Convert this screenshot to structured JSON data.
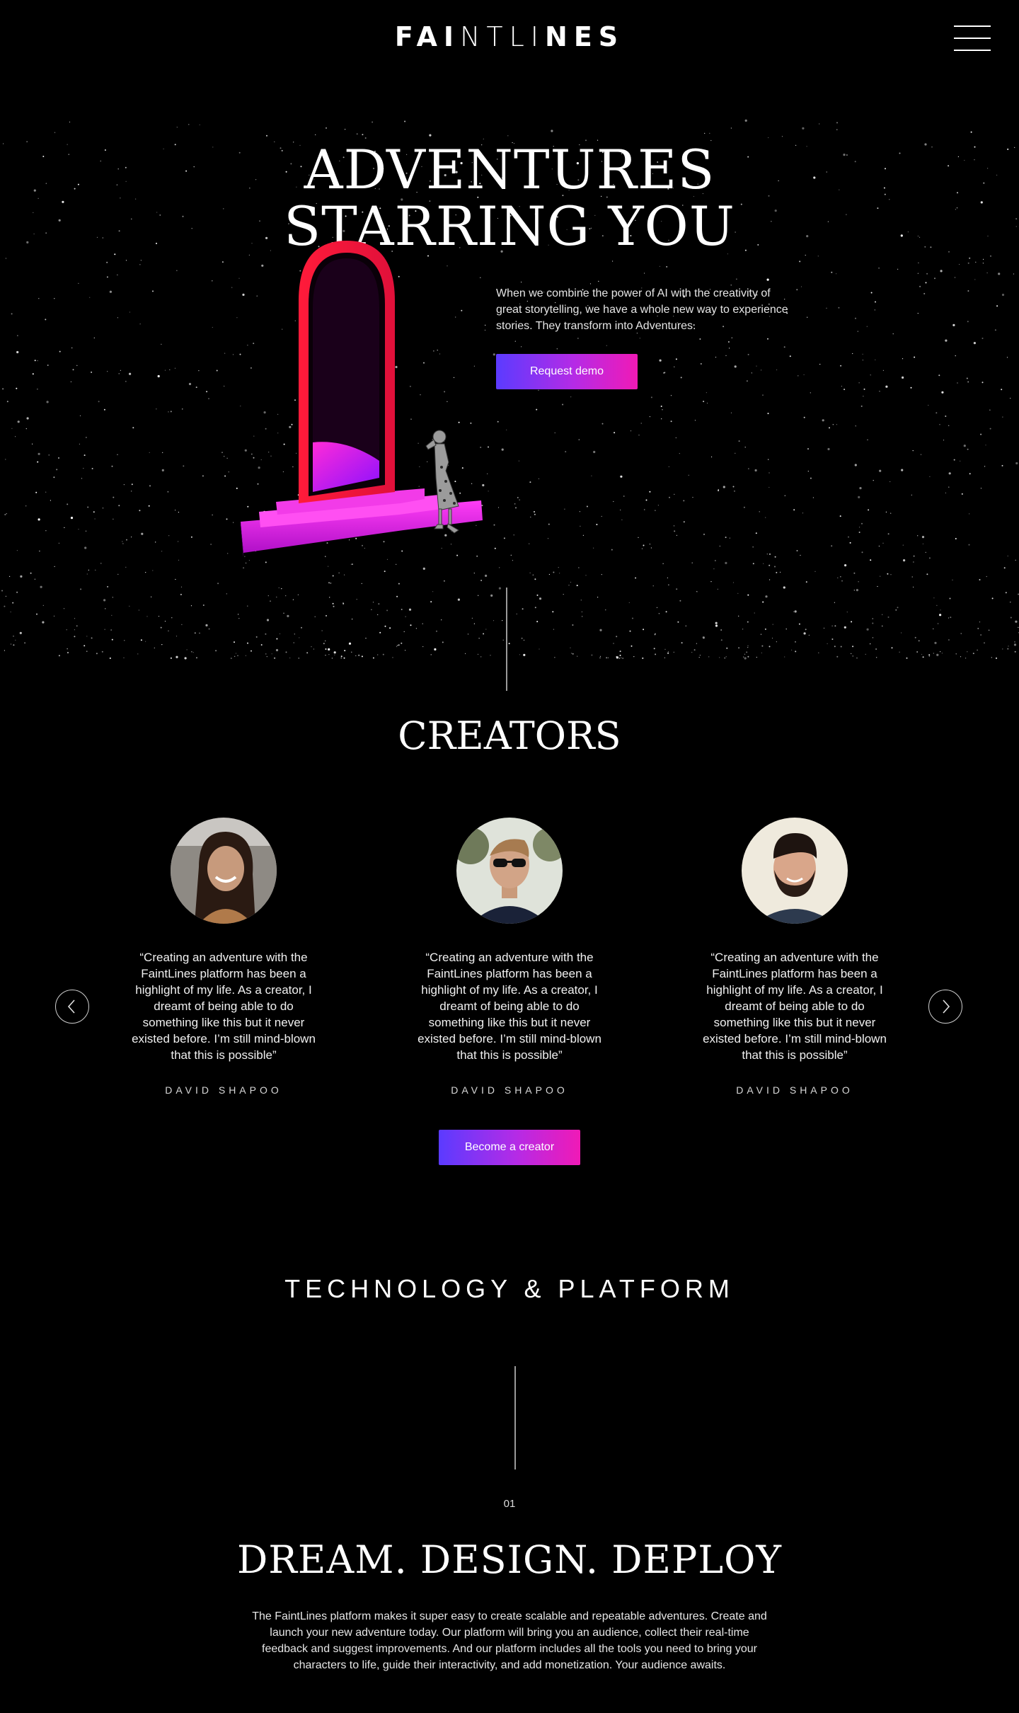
{
  "header": {
    "logo_bold_1": "FAI",
    "logo_thin": "NTLI",
    "logo_bold_2": "NES",
    "menu_icon": "hamburger-menu-icon"
  },
  "hero": {
    "title_line1": "ADVENTURES",
    "title_line2": "STARRING YOU",
    "description": "When we combine the power of AI with the creativity of great storytelling, we have a whole new way to experience stories. They transform into Adventures.",
    "cta_label": "Request demo"
  },
  "creators": {
    "title": "CREATORS",
    "items": [
      {
        "quote": "“Creating an adventure with the FaintLines platform has been a highlight of my life. As a creator, I dreamt of being able to do something like this but it never existed before. I’m still mind-blown that this is possible”",
        "author": "DAVID SHAPOO"
      },
      {
        "quote": "“Creating an adventure with the FaintLines platform has been a highlight of my life. As a creator, I dreamt of being able to do something like this but it never existed before. I’m still mind-blown that this is possible”",
        "author": "DAVID SHAPOO"
      },
      {
        "quote": "“Creating an adventure with the FaintLines platform has been a highlight of my life. As a creator, I dreamt of being able to do something like this but it never existed before. I’m still mind-blown that this is possible”",
        "author": "DAVID SHAPOO"
      }
    ],
    "prev_icon": "chevron-left-icon",
    "next_icon": "chevron-right-icon",
    "cta_label": "Become a creator"
  },
  "technology": {
    "title": "TECHNOLOGY & PLATFORM",
    "step_number": "01",
    "step_title": "DREAM. DESIGN. DEPLOY",
    "step_text": "The FaintLines platform makes it super easy to create scalable and repeatable adventures. Create and launch your new adventure today. Our platform will bring you an audience, collect their real-time feedback and suggest improvements. And our platform includes all the tools you need to bring your characters to life, guide their interactivity, and add monetization. Your audience awaits."
  },
  "colors": {
    "background": "#000000",
    "gradient_start": "#5b3bff",
    "gradient_end": "#f01ab6",
    "portal_red": "#ff1744",
    "portal_magenta": "#e01ee6"
  }
}
